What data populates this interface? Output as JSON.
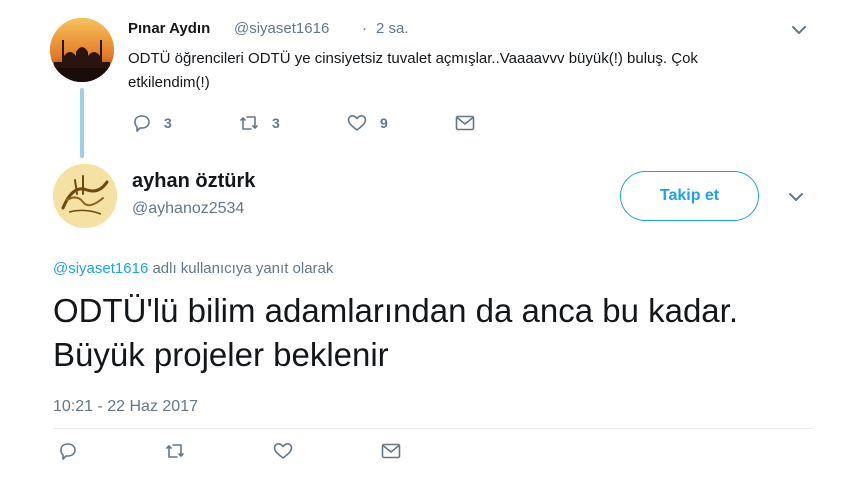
{
  "parent_tweet": {
    "name": "Pınar Aydın",
    "handle": "@siyaset1616",
    "separator": "·",
    "time": "2 sa.",
    "text": "ODTÜ öğrencileri ODTÜ ye cinsiyetsiz tuvalet açmışlar..Vaaaavvv büyük(!) buluş. Çok etkilendim(!)",
    "actions": {
      "reply_count": "3",
      "retweet_count": "3",
      "like_count": "9"
    }
  },
  "main_tweet": {
    "name": "ayhan öztürk",
    "handle": "@ayhanoz2534",
    "follow_label": "Takip et",
    "reply_to_mention": "@siyaset1616",
    "reply_to_suffix": " adlı kullanıcıya yanıt olarak",
    "text": "ODTÜ'lü bilim adamlarından da anca bu kadar. Büyük projeler beklenir",
    "timestamp": "10:21 - 22 Haz 2017"
  },
  "icons": {
    "reply": "reply-icon",
    "retweet": "retweet-icon",
    "like": "heart-icon",
    "message": "envelope-icon",
    "more": "chevron-down-icon"
  },
  "colors": {
    "accent": "#1da1f2",
    "secondary_text": "#657786",
    "thread_line": "#9fd0ea"
  }
}
